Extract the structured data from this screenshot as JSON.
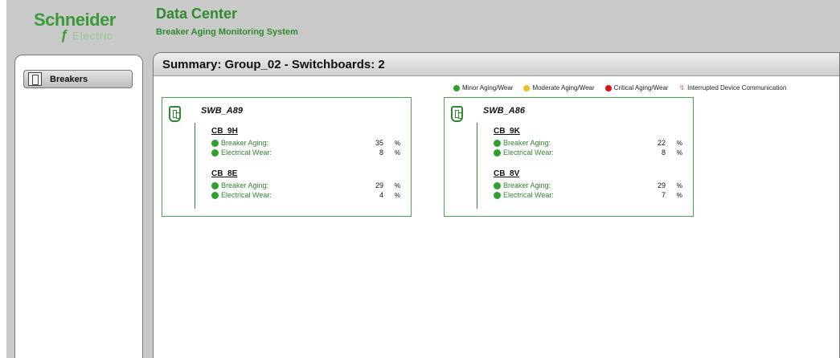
{
  "brand": {
    "name": "Schneider",
    "sub": "Electric"
  },
  "app": {
    "title": "Data Center",
    "subtitle": "Breaker Aging Monitoring System"
  },
  "nav": {
    "items": [
      {
        "label": "Breakers",
        "icon": "breaker-icon"
      }
    ]
  },
  "summary": {
    "title": "Summary: Group_02 - Switchboards: 2"
  },
  "legend": [
    {
      "label": "Minor Aging/Wear",
      "color": "#2fa02f"
    },
    {
      "label": "Moderate Aging/Wear",
      "color": "#f0c020"
    },
    {
      "label": "Critical Aging/Wear",
      "color": "#dd1111"
    },
    {
      "label": "Interrupted Device Communication",
      "icon": "interrupted-communication-icon"
    }
  ],
  "switchboards": [
    {
      "name": "SWB_A89",
      "breakers": [
        {
          "name": "CB_9H",
          "aging_label": "Breaker Aging:",
          "aging": "35",
          "wear_label": "Electrical Wear:",
          "wear": "8",
          "unit": "%"
        },
        {
          "name": "CB_8E",
          "aging_label": "Breaker Aging:",
          "aging": "29",
          "wear_label": "Electrical Wear:",
          "wear": "4",
          "unit": "%"
        }
      ]
    },
    {
      "name": "SWB_A86",
      "breakers": [
        {
          "name": "CB_9K",
          "aging_label": "Breaker Aging:",
          "aging": "22",
          "wear_label": "Electrical Wear:",
          "wear": "8",
          "unit": "%"
        },
        {
          "name": "CB_8V",
          "aging_label": "Breaker Aging:",
          "aging": "29",
          "wear_label": "Electrical Wear:",
          "wear": "7",
          "unit": "%"
        }
      ]
    }
  ]
}
